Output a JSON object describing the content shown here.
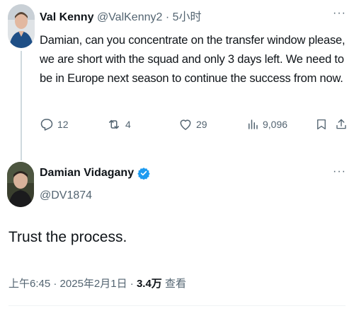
{
  "reply_tweet": {
    "author_name": "Val Kenny",
    "author_handle": "@ValKenny2",
    "separator": "·",
    "time_ago": "5小时",
    "text": "Damian, can you concentrate on the transfer window please, we are short with the squad and only 3 days left. We need to be in Europe next season to continue the success from now.",
    "more_glyph": "···",
    "stats": {
      "replies": "12",
      "retweets": "4",
      "likes": "29",
      "views": "9,096"
    },
    "icons": [
      "reply-icon",
      "retweet-icon",
      "like-icon",
      "views-icon",
      "bookmark-icon",
      "share-icon"
    ]
  },
  "main_tweet": {
    "author_name": "Damian Vidagany",
    "author_handle": "@DV1874",
    "verified_icon": "verified-badge-icon",
    "more_glyph": "···",
    "text": "Trust the process.",
    "time": "上午6:45",
    "separator_1": "·",
    "date": "2025年2月1日",
    "separator_2": "·",
    "views_count": "3.4万",
    "views_label": "查看"
  },
  "colors": {
    "text_primary": "#0f1419",
    "text_secondary": "#536471",
    "verified_blue": "#1d9bf0",
    "thread_line": "#cfd9de"
  }
}
